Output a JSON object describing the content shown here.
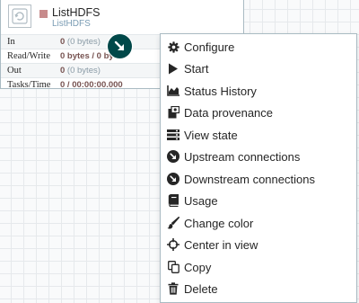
{
  "processor": {
    "name": "ListHDFS",
    "type": "ListHDFS",
    "stats": [
      {
        "label": "In",
        "count": "0",
        "unit": " (0 bytes)"
      },
      {
        "label": "Read/Write",
        "count": "0 bytes / 0 byte",
        "unit": ""
      },
      {
        "label": "Out",
        "count": "0",
        "unit": " (0 bytes)"
      },
      {
        "label": "Tasks/Time",
        "count": "0 / 00:00:00.000",
        "unit": ""
      }
    ]
  },
  "context_menu": {
    "items": [
      {
        "label": "Configure",
        "icon": "gear-icon"
      },
      {
        "label": "Start",
        "icon": "play-icon"
      },
      {
        "label": "Status History",
        "icon": "area-chart-icon"
      },
      {
        "label": "Data provenance",
        "icon": "provenance-icon"
      },
      {
        "label": "View state",
        "icon": "state-icon"
      },
      {
        "label": "Upstream connections",
        "icon": "upstream-icon"
      },
      {
        "label": "Downstream connections",
        "icon": "downstream-icon"
      },
      {
        "label": "Usage",
        "icon": "book-icon"
      },
      {
        "label": "Change color",
        "icon": "paintbrush-icon"
      },
      {
        "label": "Center in view",
        "icon": "crosshairs-icon"
      },
      {
        "label": "Copy",
        "icon": "copy-icon"
      },
      {
        "label": "Delete",
        "icon": "trash-icon"
      }
    ]
  },
  "colors": {
    "processor_state": "#c78b8c",
    "connection_badge": "#004849",
    "stat_value": "#775351",
    "type_text": "#7a9cb4"
  }
}
